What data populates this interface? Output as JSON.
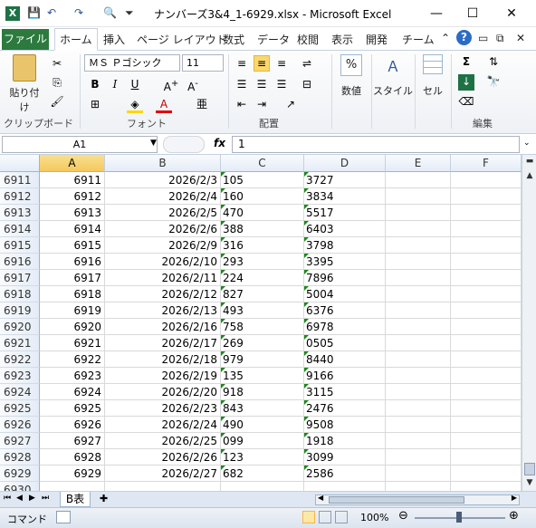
{
  "window": {
    "title": "ナンバーズ3&4_1-6929.xlsx  -  Microsoft Excel",
    "app_icon": "X",
    "minimize": "—",
    "maximize": "☐",
    "close": "✕"
  },
  "tabs": {
    "file": "ファイル",
    "items": [
      "ホーム",
      "挿入",
      "ページ レイアウト",
      "数式",
      "データ",
      "校閲",
      "表示",
      "開発",
      "チーム"
    ]
  },
  "ribbon": {
    "paste": "貼り付け",
    "clipboard": "クリップボード",
    "font_name": "ＭＳ Ｐゴシック",
    "font_size": "11",
    "font_group": "フォント",
    "alignment": "配置",
    "number": "数値",
    "style": "スタイル",
    "cells": "セル",
    "editing": "編集",
    "bold": "B",
    "italic": "I",
    "underline": "U",
    "percent": "%"
  },
  "formula_bar": {
    "name_box": "A1",
    "fx": "fx",
    "value": "1"
  },
  "columns": [
    "A",
    "B",
    "C",
    "D",
    "E",
    "F"
  ],
  "rows": [
    {
      "n": "6911",
      "a": "6911",
      "b": "2026/2/3",
      "c": "105",
      "d": "3727"
    },
    {
      "n": "6912",
      "a": "6912",
      "b": "2026/2/4",
      "c": "160",
      "d": "3834"
    },
    {
      "n": "6913",
      "a": "6913",
      "b": "2026/2/5",
      "c": "470",
      "d": "5517"
    },
    {
      "n": "6914",
      "a": "6914",
      "b": "2026/2/6",
      "c": "388",
      "d": "6403"
    },
    {
      "n": "6915",
      "a": "6915",
      "b": "2026/2/9",
      "c": "316",
      "d": "3798"
    },
    {
      "n": "6916",
      "a": "6916",
      "b": "2026/2/10",
      "c": "293",
      "d": "3395"
    },
    {
      "n": "6917",
      "a": "6917",
      "b": "2026/2/11",
      "c": "224",
      "d": "7896"
    },
    {
      "n": "6918",
      "a": "6918",
      "b": "2026/2/12",
      "c": "827",
      "d": "5004"
    },
    {
      "n": "6919",
      "a": "6919",
      "b": "2026/2/13",
      "c": "493",
      "d": "6376"
    },
    {
      "n": "6920",
      "a": "6920",
      "b": "2026/2/16",
      "c": "758",
      "d": "6978"
    },
    {
      "n": "6921",
      "a": "6921",
      "b": "2026/2/17",
      "c": "269",
      "d": "0505"
    },
    {
      "n": "6922",
      "a": "6922",
      "b": "2026/2/18",
      "c": "979",
      "d": "8440"
    },
    {
      "n": "6923",
      "a": "6923",
      "b": "2026/2/19",
      "c": "135",
      "d": "9166"
    },
    {
      "n": "6924",
      "a": "6924",
      "b": "2026/2/20",
      "c": "918",
      "d": "3115"
    },
    {
      "n": "6925",
      "a": "6925",
      "b": "2026/2/23",
      "c": "843",
      "d": "2476"
    },
    {
      "n": "6926",
      "a": "6926",
      "b": "2026/2/24",
      "c": "490",
      "d": "9508"
    },
    {
      "n": "6927",
      "a": "6927",
      "b": "2026/2/25",
      "c": "099",
      "d": "1918"
    },
    {
      "n": "6928",
      "a": "6928",
      "b": "2026/2/26",
      "c": "123",
      "d": "3099"
    },
    {
      "n": "6929",
      "a": "6929",
      "b": "2026/2/27",
      "c": "682",
      "d": "2586"
    },
    {
      "n": "6930",
      "a": "",
      "b": "",
      "c": "",
      "d": ""
    }
  ],
  "sheet": {
    "tab": "B表"
  },
  "status": {
    "mode": "コマンド",
    "zoom": "100%"
  }
}
